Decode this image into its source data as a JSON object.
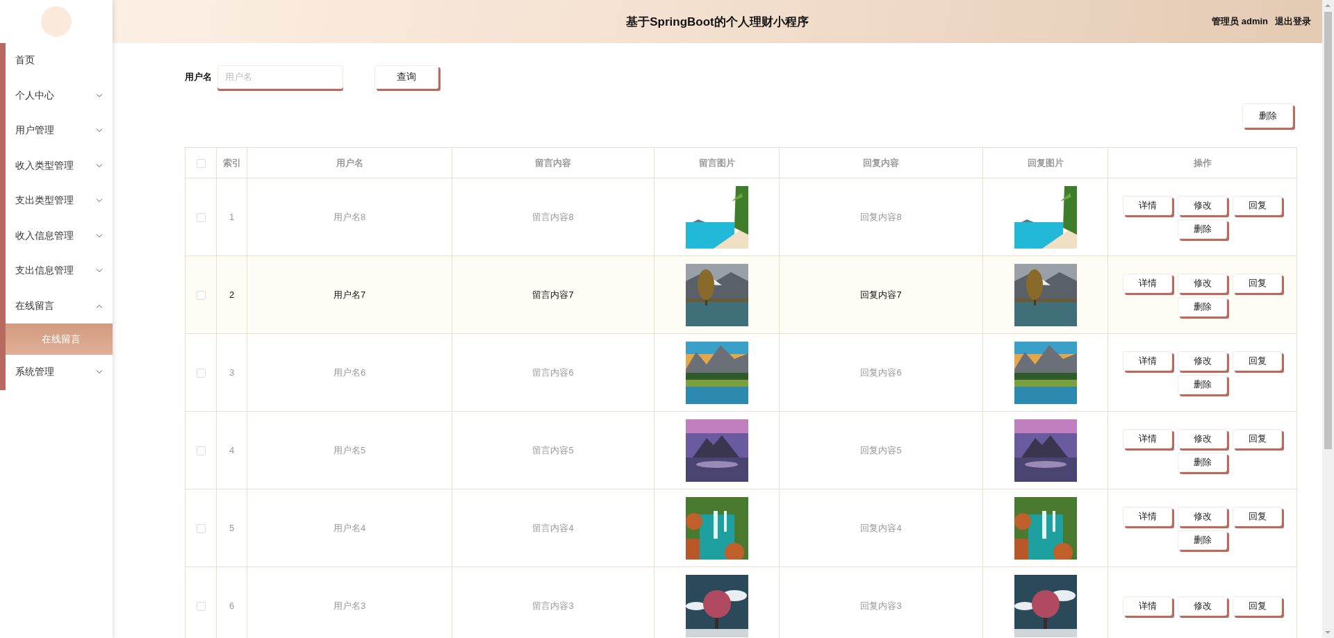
{
  "sidebar": {
    "items": [
      {
        "label": "首页",
        "kind": "link"
      },
      {
        "label": "个人中心",
        "kind": "group",
        "expanded": false
      },
      {
        "label": "用户管理",
        "kind": "group",
        "expanded": false
      },
      {
        "label": "收入类型管理",
        "kind": "group",
        "expanded": false
      },
      {
        "label": "支出类型管理",
        "kind": "group",
        "expanded": false
      },
      {
        "label": "收入信息管理",
        "kind": "group",
        "expanded": false
      },
      {
        "label": "支出信息管理",
        "kind": "group",
        "expanded": false
      },
      {
        "label": "在线留言",
        "kind": "group",
        "expanded": true,
        "children": [
          {
            "label": "在线留言",
            "selected": true
          }
        ]
      },
      {
        "label": "系统管理",
        "kind": "group",
        "expanded": false
      }
    ]
  },
  "header": {
    "title": "基于SpringBoot的个人理财小程序",
    "user": "管理员 admin",
    "logout": "退出登录"
  },
  "search": {
    "label": "用户名",
    "placeholder": "用户名",
    "button": "查询"
  },
  "toolbar": {
    "buttons": [
      "删除"
    ]
  },
  "table": {
    "select_all": {
      "checked": false
    },
    "columns": [
      "索引",
      "用户名",
      "留言内容",
      "留言图片",
      "回复内容",
      "回复图片",
      "操作"
    ],
    "rows": [
      {
        "checked": false,
        "hovered": false,
        "index": "1",
        "username": "用户名8",
        "message": "留言内容8",
        "message_image": {
          "kind": "picture"
        },
        "reply": "回复内容8",
        "reply_image": {
          "kind": "picture"
        },
        "actions": [
          "详情",
          "修改",
          "回复",
          "删除"
        ]
      },
      {
        "checked": false,
        "hovered": true,
        "index": "2",
        "username": "用户名7",
        "message": "留言内容7",
        "message_image": {
          "kind": "picture"
        },
        "reply": "回复内容7",
        "reply_image": {
          "kind": "picture"
        },
        "actions": [
          "详情",
          "修改",
          "回复",
          "删除"
        ]
      },
      {
        "checked": false,
        "hovered": false,
        "index": "3",
        "username": "用户名6",
        "message": "留言内容6",
        "message_image": {
          "kind": "picture"
        },
        "reply": "回复内容6",
        "reply_image": {
          "kind": "picture"
        },
        "actions": [
          "详情",
          "修改",
          "回复",
          "删除"
        ]
      },
      {
        "checked": false,
        "hovered": false,
        "index": "4",
        "username": "用户名5",
        "message": "留言内容5",
        "message_image": {
          "kind": "picture"
        },
        "reply": "回复内容5",
        "reply_image": {
          "kind": "picture"
        },
        "actions": [
          "详情",
          "修改",
          "回复",
          "删除"
        ]
      },
      {
        "checked": false,
        "hovered": false,
        "index": "5",
        "username": "用户名4",
        "message": "留言内容4",
        "message_image": {
          "kind": "picture"
        },
        "reply": "回复内容4",
        "reply_image": {
          "kind": "picture"
        },
        "actions": [
          "详情",
          "修改",
          "回复",
          "删除"
        ]
      },
      {
        "checked": false,
        "hovered": false,
        "index": "6",
        "username": "用户名3",
        "message": "留言内容3",
        "message_image": {
          "kind": "picture"
        },
        "reply": "回复内容3",
        "reply_image": {
          "kind": "picture"
        },
        "actions": [
          "详情",
          "修改",
          "回复"
        ]
      }
    ]
  }
}
